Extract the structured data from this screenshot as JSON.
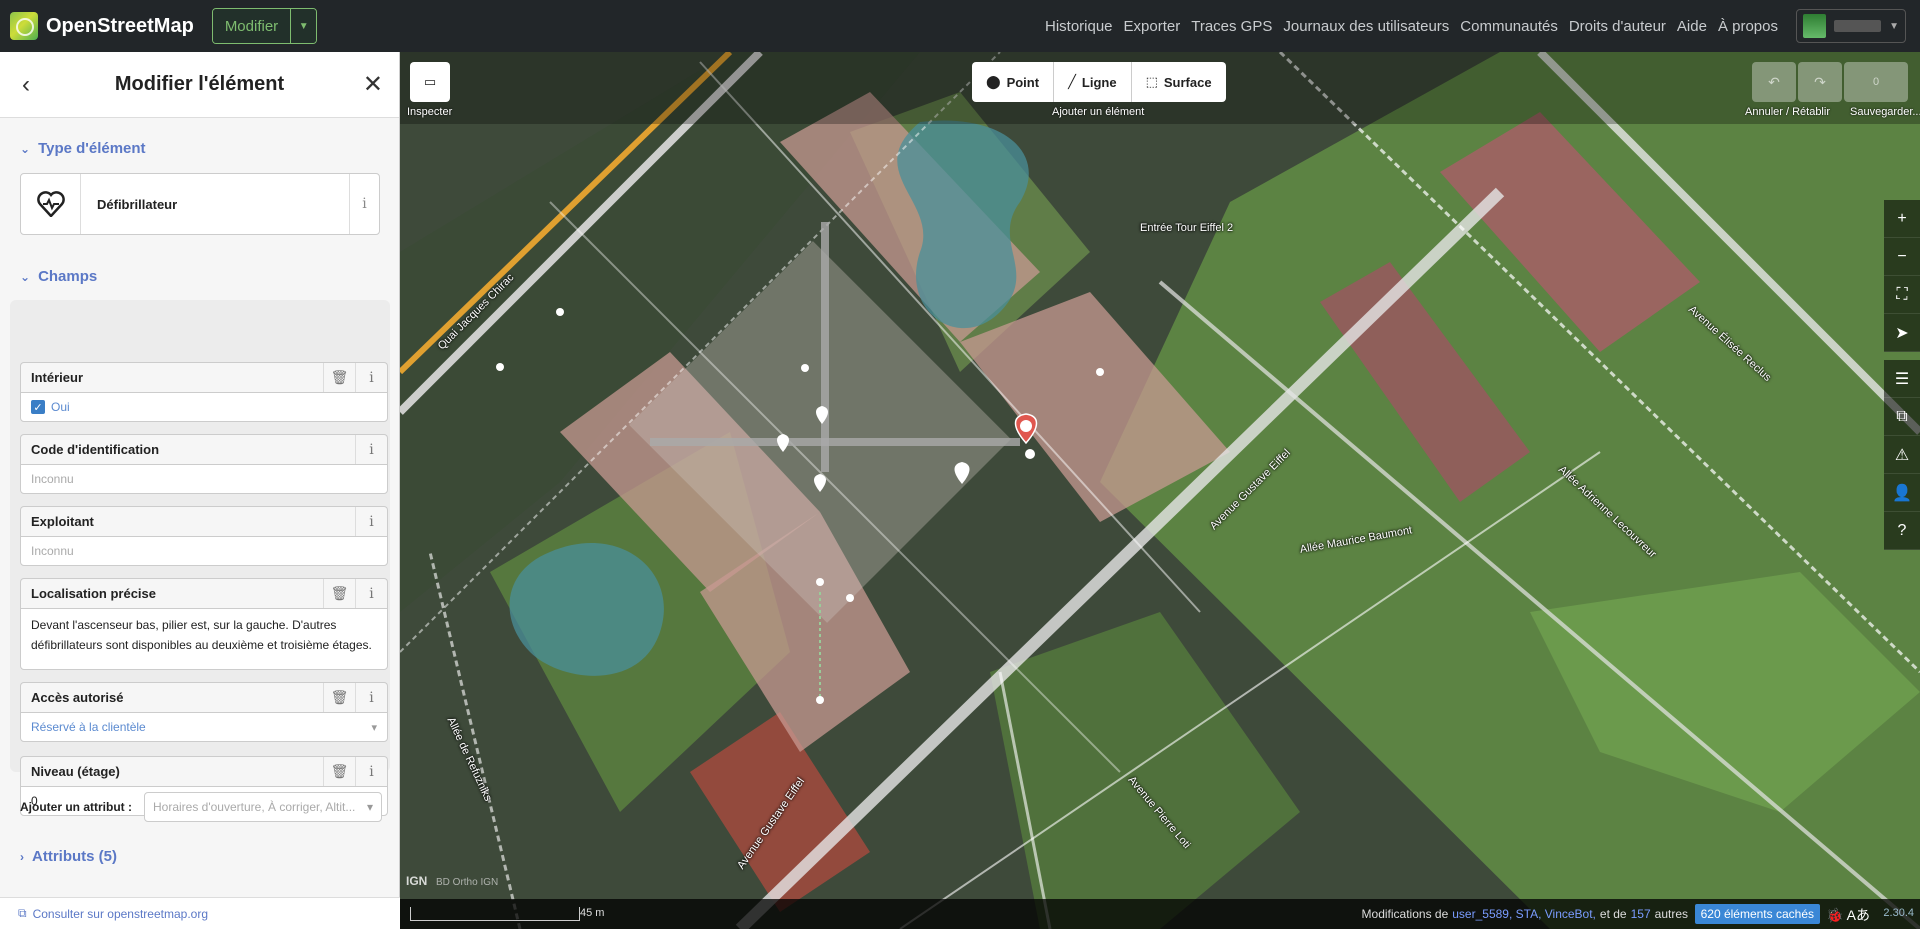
{
  "topbar": {
    "logo_text": "OpenStreetMap",
    "edit_label": "Modifier",
    "nav": [
      "Historique",
      "Exporter",
      "Traces GPS",
      "Journaux des utilisateurs",
      "Communautés",
      "Droits d'auteur",
      "Aide",
      "À propos"
    ]
  },
  "sidebar": {
    "title": "Modifier l'élément",
    "type_section": "Type d'élément",
    "type_name": "Défibrillateur",
    "fields_section": "Champs",
    "fields": {
      "indoor": {
        "label": "Intérieur",
        "value": "Oui"
      },
      "ref": {
        "label": "Code d'identification",
        "placeholder": "Inconnu"
      },
      "operator": {
        "label": "Exploitant",
        "placeholder": "Inconnu"
      },
      "location": {
        "label": "Localisation précise",
        "value": "Devant l'ascenseur bas, pilier est, sur la gauche. D'autres défibrillateurs sont disponibles au deuxième et troisième étages."
      },
      "access": {
        "label": "Accès autorisé",
        "value": "Réservé à la clientèle"
      },
      "level": {
        "label": "Niveau (étage)",
        "value": "0"
      }
    },
    "add_tag_label": "Ajouter un attribut :",
    "add_tag_placeholder": "Horaires d'ouverture, À corriger, Altit...",
    "attributes_label": "Attributs (5)",
    "footer_link": "Consulter sur openstreetmap.org"
  },
  "map": {
    "inspector_label": "Inspecter",
    "modes": [
      "Point",
      "Ligne",
      "Surface"
    ],
    "add_caption": "Ajouter un élément",
    "undo_caption": "Annuler / Rétablir",
    "save_caption": "Sauvegarder...",
    "save_count": "0",
    "streets": [
      "Quai Jacques Chirac",
      "Entrée Tour Eiffel 2",
      "Avenue Élisée Reclus",
      "Allée Adrienne Lecouvreur",
      "Avenue Gustave Eiffel",
      "Allée Maurice Baumont",
      "Allée de Refuzniks",
      "Avenue Gustave Eiffel",
      "Avenue Pierre Loti"
    ],
    "scale_label": "45 m",
    "ign": "IGN",
    "attribution": "BD Ortho IGN",
    "status": {
      "prefix": "Modifications de",
      "users": "user_5589, STA, VinceBot,",
      "middle": "et de",
      "count": "157",
      "suffix": "autres",
      "hidden": "620 éléments cachés",
      "version": "2.30.4"
    }
  },
  "colors": {
    "accent": "#7ebc6f",
    "link": "#5b78c6",
    "topbar": "#222629",
    "badge": "#3a87d6"
  }
}
